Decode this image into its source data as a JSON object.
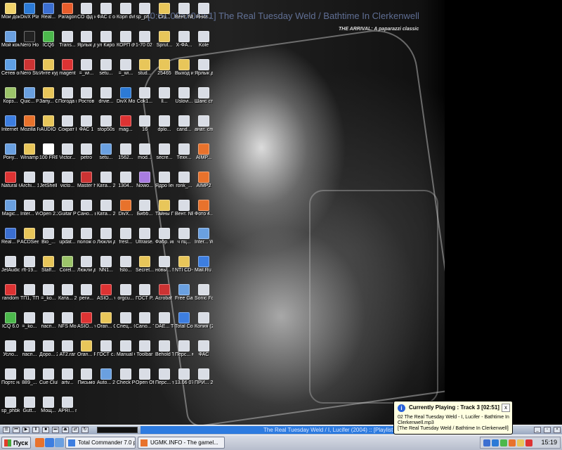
{
  "window": {
    "title": "[0:01:00/0:04:51] The Real Tuesday Weld / Bathtime In Clerkenwell"
  },
  "wallpaper": {
    "caption": "THE ARRIVAL: A paparazzi classic"
  },
  "desktop": {
    "icons": [
      {
        "label": "Мои докум...",
        "color": "#f1d36b"
      },
      {
        "label": "DivX Player",
        "color": "#2c7ad6"
      },
      {
        "label": "Real...",
        "color": "#3b6fd1"
      },
      {
        "label": "Paragon Partiti...",
        "color": "#e85d2c"
      },
      {
        "label": "CO фд корт",
        "color": "#d9dde5"
      },
      {
        "label": "ФАС с отк...",
        "color": "#d9dde5"
      },
      {
        "label": "Корп dvl 0...",
        "color": "#d9dde5"
      },
      {
        "label": "sp_ph...",
        "color": "#d9dde5"
      },
      {
        "label": "Cru...",
        "color": "#e8c65a"
      },
      {
        "label": "Вент. NEW...",
        "color": "#d9dde5"
      },
      {
        "label": "Янки...",
        "color": "#d9dde5"
      },
      {
        "label": "Мой компь...",
        "color": "#6aa0e0"
      },
      {
        "label": "Nero Home",
        "color": "#222"
      },
      {
        "label": "ICQ6",
        "color": "#4cb84c"
      },
      {
        "label": "Trans...",
        "color": "#d9dde5"
      },
      {
        "label": "Ярлык для...",
        "color": "#d9dde5"
      },
      {
        "label": "ул Кирo...",
        "color": "#d9dde5"
      },
      {
        "label": "КОРП dvl 0...",
        "color": "#d9dde5"
      },
      {
        "label": "1-70 02 01",
        "color": "#d9dde5"
      },
      {
        "label": "Sprut...",
        "color": "#e8c65a"
      },
      {
        "label": "Х-ФА...",
        "color": "#d9dde5"
      },
      {
        "label": "Kole",
        "color": "#d9dde5"
      },
      {
        "label": "Сетев окру...",
        "color": "#5fa0e6"
      },
      {
        "label": "Nero Start...",
        "color": "#c33"
      },
      {
        "label": "Инте курс...",
        "color": "#e8c65a"
      },
      {
        "label": "magent",
        "color": "#d33"
      },
      {
        "label": "=_wi...",
        "color": "#d9dde5"
      },
      {
        "label": "setu...",
        "color": "#d9dde5"
      },
      {
        "label": "=_wi...",
        "color": "#d9dde5"
      },
      {
        "label": "stud...",
        "color": "#e8c65a"
      },
      {
        "label": "25465",
        "color": "#e8c65a"
      },
      {
        "label": "Выход из в...",
        "color": "#e8c65a"
      },
      {
        "label": "Ярлык для...",
        "color": "#d9dde5"
      },
      {
        "label": "Корз...",
        "color": "#9cc46a"
      },
      {
        "label": "Quic... Player",
        "color": "#6aa0e0"
      },
      {
        "label": "Запу... Googl...",
        "color": "#e8c65a"
      },
      {
        "label": "Погода в Мо...",
        "color": "#d9dde5"
      },
      {
        "label": "Ростов",
        "color": "#d9dde5"
      },
      {
        "label": "drvie...",
        "color": "#d9dde5"
      },
      {
        "label": "DivX Movies",
        "color": "#2c7ad6"
      },
      {
        "label": "Cok1...",
        "color": "#d9dde5"
      },
      {
        "label": "ll...",
        "color": "#d9dde5"
      },
      {
        "label": "Uslovi...",
        "color": "#d9dde5"
      },
      {
        "label": "Шанс стат...",
        "color": "#d9dde5"
      },
      {
        "label": "Internet Explorer",
        "color": "#3d7ee0"
      },
      {
        "label": "Mozilla Firefox",
        "color": "#e8722c"
      },
      {
        "label": "iAUDIO 6 Ru...",
        "color": "#e8c65a"
      },
      {
        "label": "Сократ Перс...",
        "color": "#d9dde5"
      },
      {
        "label": "ФАС 1",
        "color": "#d9dde5"
      },
      {
        "label": "stop50s",
        "color": "#d9dde5"
      },
      {
        "label": "mag...",
        "color": "#d33"
      },
      {
        "label": "16",
        "color": "#d9dde5"
      },
      {
        "label": "dplo...",
        "color": "#d9dde5"
      },
      {
        "label": "cand...",
        "color": "#d9dde5"
      },
      {
        "label": "анат. списо...",
        "color": "#d9dde5"
      },
      {
        "label": "Рону...",
        "color": "#6aa0e0"
      },
      {
        "label": "Winamp",
        "color": "#e8c65a"
      },
      {
        "label": "100 FREE...",
        "color": "#fff"
      },
      {
        "label": "Victor...",
        "color": "#d9dde5"
      },
      {
        "label": "petro",
        "color": "#d9dde5"
      },
      {
        "label": "setu...",
        "color": "#6aa0e0"
      },
      {
        "label": "1562...",
        "color": "#d9dde5"
      },
      {
        "label": "mod...",
        "color": "#d9dde5"
      },
      {
        "label": "secre...",
        "color": "#d9dde5"
      },
      {
        "label": "Техн...",
        "color": "#d9dde5"
      },
      {
        "label": "AIMP...",
        "color": "#e8722c"
      },
      {
        "label": "Natural Color",
        "color": "#d33"
      },
      {
        "label": "Archi... 10",
        "color": "#d9dde5"
      },
      {
        "label": "JetShell",
        "color": "#d9dde5"
      },
      {
        "label": "victo...",
        "color": "#d9dde5"
      },
      {
        "label": "Master horo...",
        "color": "#c33"
      },
      {
        "label": "Ката... 2006 ...",
        "color": "#d9dde5"
      },
      {
        "label": "1304...",
        "color": "#d9dde5"
      },
      {
        "label": "Nowo...",
        "color": "#a87ce0"
      },
      {
        "label": "Ядро Iewu...",
        "color": "#d9dde5"
      },
      {
        "label": "ronk_...",
        "color": "#d9dde5"
      },
      {
        "label": "AIMP2",
        "color": "#e8722c"
      },
      {
        "label": "Magic...",
        "color": "#6aa0e0"
      },
      {
        "label": "Inter... WinD...",
        "color": "#d9dde5"
      },
      {
        "label": "Open 2.2.1...",
        "color": "#d9dde5"
      },
      {
        "label": "Guitar Pro 5",
        "color": "#d9dde5"
      },
      {
        "label": "Сано... вожд...",
        "color": "#d9dde5"
      },
      {
        "label": "Ката... 2006 ...",
        "color": "#d9dde5"
      },
      {
        "label": "DivX...",
        "color": "#e8722c"
      },
      {
        "label": "Бибб...",
        "color": "#d9dde5"
      },
      {
        "label": "Тайны Горбо...",
        "color": "#e8c65a"
      },
      {
        "label": "Вент. NEW...",
        "color": "#d9dde5"
      },
      {
        "label": "Фото 4...",
        "color": "#e8722c"
      },
      {
        "label": "Real... Player",
        "color": "#3b6fd1"
      },
      {
        "label": "ACDSee Pro",
        "color": "#e8c65a"
      },
      {
        "label": "Bio_...",
        "color": "#d9dde5"
      },
      {
        "label": "updat...",
        "color": "#d9dde5"
      },
      {
        "label": "полож осно...",
        "color": "#d9dde5"
      },
      {
        "label": "Люкли дыхо...",
        "color": "#d9dde5"
      },
      {
        "label": "fresl...",
        "color": "#d9dde5"
      },
      {
        "label": "Ultraise... SX3",
        "color": "#d9dde5"
      },
      {
        "label": "Фабр. игр...",
        "color": "#d9dde5"
      },
      {
        "label": "ч пц...",
        "color": "#d9dde5"
      },
      {
        "label": "Inter... WinD...",
        "color": "#6aa0e0"
      },
      {
        "label": "JetAudio",
        "color": "#d9dde5"
      },
      {
        "label": "rft-19...",
        "color": "#d9dde5"
      },
      {
        "label": "Staff...",
        "color": "#e8c65a"
      },
      {
        "label": "Corel...",
        "color": "#9cc46a"
      },
      {
        "label": "Люкли дыхо...",
        "color": "#d9dde5"
      },
      {
        "label": "NN1...",
        "color": "#d9dde5"
      },
      {
        "label": "fsto...",
        "color": "#d9dde5"
      },
      {
        "label": "Secret... of Ti...",
        "color": "#e8c65a"
      },
      {
        "label": "новы... NEW...",
        "color": "#d9dde5"
      },
      {
        "label": "NTI CD-M...",
        "color": "#e8c65a"
      },
      {
        "label": "Mail.Ru Агент",
        "color": "#3d7ee0"
      },
      {
        "label": "random",
        "color": "#d33"
      },
      {
        "label": "ТП1, ТП2,...",
        "color": "#d9dde5"
      },
      {
        "label": "=_ko...",
        "color": "#d9dde5"
      },
      {
        "label": "Ката... 2006 ...",
        "color": "#d9dde5"
      },
      {
        "label": "реги...",
        "color": "#d9dde5"
      },
      {
        "label": "ASIO... v2.0...",
        "color": "#d33"
      },
      {
        "label": "orgcu...",
        "color": "#d9dde5"
      },
      {
        "label": "ГОСТ Р...",
        "color": "#d9dde5"
      },
      {
        "label": "Acrobat Read...",
        "color": "#c33"
      },
      {
        "label": "Free Gam...",
        "color": "#6aa0e0"
      },
      {
        "label": "Sonic Focus",
        "color": "#d9dde5"
      },
      {
        "label": "ICQ 6.0",
        "color": "#4cb84c"
      },
      {
        "label": "=_ko...",
        "color": "#d9dde5"
      },
      {
        "label": "пасп...",
        "color": "#d9dde5"
      },
      {
        "label": "NFS Most...",
        "color": "#d9dde5"
      },
      {
        "label": "ASIO... v2 On...",
        "color": "#d33"
      },
      {
        "label": "Oran... Catalog",
        "color": "#e8c65a"
      },
      {
        "label": "Спец... 04...",
        "color": "#d9dde5"
      },
      {
        "label": "Cano... Toolb...",
        "color": "#d9dde5"
      },
      {
        "label": "DAE... Tools",
        "color": "#d9dde5"
      },
      {
        "label": "Total Com...",
        "color": "#3d7ee0"
      },
      {
        "label": "Копия (2) г...",
        "color": "#d9dde5"
      },
      {
        "label": "Усло...",
        "color": "#d9dde5"
      },
      {
        "label": "пасп...",
        "color": "#d9dde5"
      },
      {
        "label": "Доро... 2221...",
        "color": "#d9dde5"
      },
      {
        "label": "AT2.rar",
        "color": "#d9dde5"
      },
      {
        "label": "Oran... Player",
        "color": "#e8c65a"
      },
      {
        "label": "ГОСТ с.п...",
        "color": "#d9dde5"
      },
      {
        "label": "Manual Can...",
        "color": "#d9dde5"
      },
      {
        "label": "Toolbar",
        "color": "#d9dde5"
      },
      {
        "label": "Behold TV",
        "color": "#d9dde5"
      },
      {
        "label": "Перс... магаз...",
        "color": "#d9dde5"
      },
      {
        "label": "ФАС",
        "color": "#d9dde5"
      },
      {
        "label": "Портс на вс...",
        "color": "#d9dde5"
      },
      {
        "label": "889_...",
        "color": "#d9dde5"
      },
      {
        "label": "Cue Club",
        "color": "#d9dde5"
      },
      {
        "label": "artv...",
        "color": "#d9dde5"
      },
      {
        "label": "Письмо",
        "color": "#d9dde5"
      },
      {
        "label": "Auto... 2008",
        "color": "#6aa0e0"
      },
      {
        "label": "Check PC ...",
        "color": "#d9dde5"
      },
      {
        "label": "Open Offic...",
        "color": "#d9dde5"
      },
      {
        "label": "Перс... типе...",
        "color": "#d9dde5"
      },
      {
        "label": "13.06 07 в...",
        "color": "#d9dde5"
      },
      {
        "label": "ПРИ... 27.03...",
        "color": "#d9dde5"
      },
      {
        "label": "sp_phbk",
        "color": "#d9dde5"
      },
      {
        "label": "Gutt...",
        "color": "#d9dde5"
      },
      {
        "label": "Мощ...",
        "color": "#d9dde5"
      },
      {
        "label": "APRI... приё...",
        "color": "#d9dde5"
      }
    ]
  },
  "notification": {
    "title": "Currently Playing : Track 3 [02:51]",
    "line1": "02 The Real Tuesday Weld - I, Lucifer - Bathtime In",
    "line2": "Clerkenwell.mp3",
    "line3": "[The Real Tuesday Weld / Bathtime In Clerkenwell]",
    "close": "x"
  },
  "playerbar": {
    "marquee": "The Real Tuesday Weld / I, Lucifer (2004) :: [Playlist : Title Cycle]"
  },
  "taskbar": {
    "start_label": "Пуск",
    "tasks": [
      {
        "label": "Total Commander 7.0 pu...",
        "color": "#3d7ee0"
      },
      {
        "label": "UGMK.INFO - The gamel...",
        "color": "#e8722c"
      }
    ],
    "clock": "15:19",
    "colors": {
      "tray_bg": "#cfd4de",
      "marquee_bg": "#2d7be0"
    }
  }
}
